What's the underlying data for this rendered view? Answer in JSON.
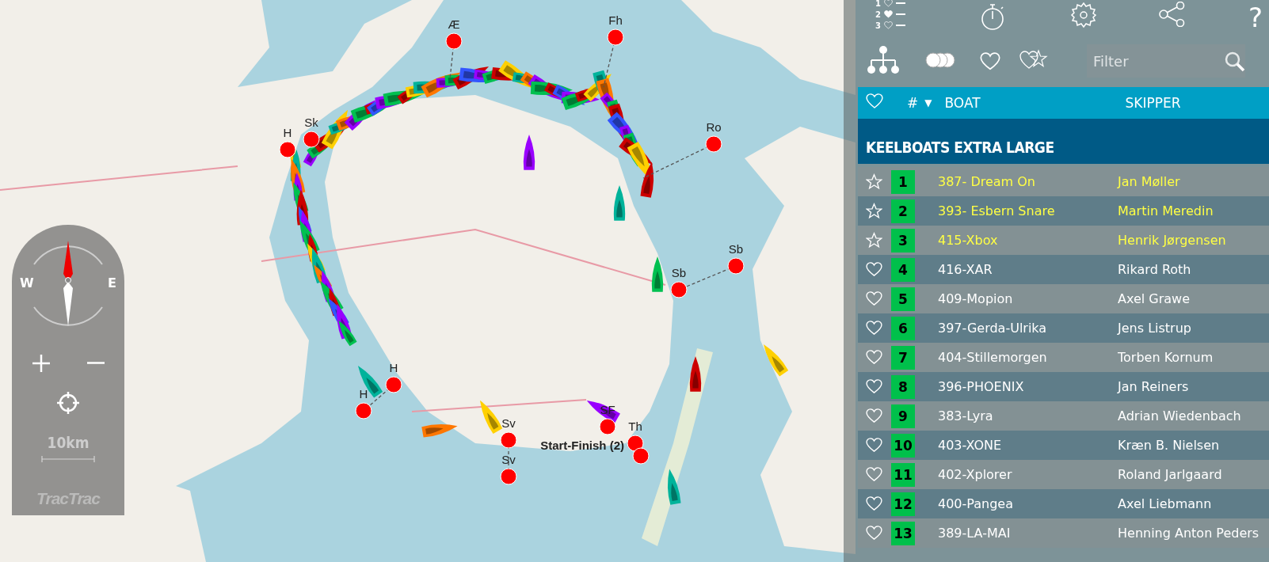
{
  "map": {
    "marks": [
      {
        "label": "Æ"
      },
      {
        "label": "Fh"
      },
      {
        "label": "Ro"
      },
      {
        "label": "Sk"
      },
      {
        "label": "H"
      },
      {
        "label": "Sb"
      },
      {
        "label": "Sb"
      },
      {
        "label": "H"
      },
      {
        "label": "H"
      },
      {
        "label": "Sv"
      },
      {
        "label": "Sv"
      },
      {
        "label": "SF"
      },
      {
        "label": "Th"
      }
    ],
    "start_finish_label": "Start-Finish (2)"
  },
  "map_controls": {
    "west": "W",
    "east": "E",
    "scale": "10km",
    "logo": "TracTrac"
  },
  "panel": {
    "legend": [
      {
        "number": "1",
        "filled": false
      },
      {
        "number": "2",
        "filled": true
      },
      {
        "number": "3",
        "filled": false
      }
    ],
    "help": "?",
    "filter": {
      "placeholder": "Filter"
    },
    "table": {
      "columns": [
        {
          "label": "#"
        },
        {
          "label": "BOAT"
        },
        {
          "label": "SKIPPER"
        }
      ],
      "sort_indicator": "▼",
      "group": "KEELBOATS EXTRA LARGE",
      "rows": [
        {
          "kind": "star",
          "rank": "1",
          "boat": "387- Dream On",
          "skipper": "Jan Møller",
          "highlighted": true
        },
        {
          "kind": "star",
          "rank": "2",
          "boat": "393- Esbern Snare",
          "skipper": "Martin Meredin",
          "highlighted": true
        },
        {
          "kind": "star",
          "rank": "3",
          "boat": "415-Xbox",
          "skipper": "Henrik Jørgensen",
          "highlighted": true
        },
        {
          "kind": "heart",
          "rank": "4",
          "boat": "416-XAR",
          "skipper": "Rikard Roth",
          "highlighted": false
        },
        {
          "kind": "heart",
          "rank": "5",
          "boat": "409-Mopion",
          "skipper": "Axel Grawe",
          "highlighted": false
        },
        {
          "kind": "heart",
          "rank": "6",
          "boat": "397-Gerda-Ulrika",
          "skipper": "Jens Listrup",
          "highlighted": false
        },
        {
          "kind": "heart",
          "rank": "7",
          "boat": "404-Stillemorgen",
          "skipper": "Torben Kornum",
          "highlighted": false
        },
        {
          "kind": "heart",
          "rank": "8",
          "boat": "396-PHOENIX",
          "skipper": "Jan Reiners",
          "highlighted": false
        },
        {
          "kind": "heart",
          "rank": "9",
          "boat": "383-Lyra",
          "skipper": "Adrian Wiedenbach",
          "highlighted": false
        },
        {
          "kind": "heart",
          "rank": "10",
          "boat": "403-XONE",
          "skipper": "Kræn B. Nielsen",
          "highlighted": false
        },
        {
          "kind": "heart",
          "rank": "11",
          "boat": "402-Xplorer",
          "skipper": "Roland Jarlgaard",
          "highlighted": false
        },
        {
          "kind": "heart",
          "rank": "12",
          "boat": "400-Pangea",
          "skipper": "Axel Liebmann",
          "highlighted": false
        },
        {
          "kind": "heart",
          "rank": "13",
          "boat": "389-LA-MAI",
          "skipper": "Henning Anton Peders",
          "highlighted": false
        }
      ]
    }
  }
}
